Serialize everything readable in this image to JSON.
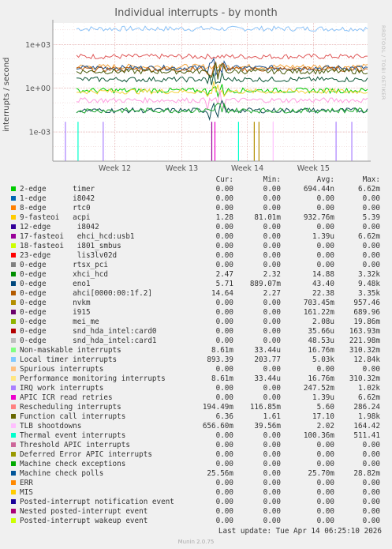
{
  "title": "Individual interrupts - by month",
  "watermark": "RRDTOOL / TOBI OETIKER",
  "chart_data": {
    "type": "line",
    "ylabel": "interrupts / second",
    "yscale": "log",
    "ylim": [
      1e-05,
      30000
    ],
    "yticks": [
      {
        "value": 1000,
        "label": "1e+03"
      },
      {
        "value": 1,
        "label": "1e+00"
      },
      {
        "value": 0.001,
        "label": "1e-03"
      }
    ],
    "xticks": [
      "Week 12",
      "Week 13",
      "Week 14",
      "Week 15"
    ],
    "grid": true,
    "series": [
      {
        "name": "Local timer interrupts",
        "color": "#8dc3f7",
        "level": 12000
      },
      {
        "name": "Rescheduling interrupts",
        "color": "#e05a5a",
        "level": 150
      },
      {
        "name": "Non-maskable interrupts",
        "color": "#f2a33d",
        "level": 30
      },
      {
        "name": "Machine check polls",
        "color": "#1b4f8a",
        "level": 25
      },
      {
        "name": "ahci[0000:00:1f.2]",
        "color": "#b7580d",
        "level": 20
      },
      {
        "name": "Function call interrupts",
        "color": "#4b5e11",
        "level": 14
      },
      {
        "name": "xhci_hcd",
        "color": "#11583a",
        "level": 4
      },
      {
        "name": "timer",
        "color": "#00cc00",
        "level": 0.7
      },
      {
        "name": "acpi",
        "color": "#f5d33d",
        "level": 0.6
      },
      {
        "name": "TLB shootdowns",
        "color": "#ff9ee0",
        "level": 0.15
      },
      {
        "name": "eno1",
        "color": "#0f4c55",
        "level": 0.03
      },
      {
        "name": "Thermal event interrupts",
        "color": "#22aa33",
        "level": 0.03
      }
    ]
  },
  "legend": {
    "headers": [
      "Cur:",
      "Min:",
      "Avg:",
      "Max:"
    ],
    "rows": [
      {
        "color": "#00cc00",
        "name": "2-edge      timer",
        "cur": "0.00",
        "min": "0.00",
        "avg": "694.44n",
        "max": "6.62m"
      },
      {
        "color": "#0066b3",
        "name": "1-edge      i8042",
        "cur": "0.00",
        "min": "0.00",
        "avg": "0.00",
        "max": "0.00"
      },
      {
        "color": "#ff8000",
        "name": "8-edge      rtc0",
        "cur": "0.00",
        "min": "0.00",
        "avg": "0.00",
        "max": "0.00"
      },
      {
        "color": "#ffcc00",
        "name": "9-fasteoi   acpi",
        "cur": "1.28",
        "min": "81.01m",
        "avg": "932.76m",
        "max": "5.39"
      },
      {
        "color": "#330099",
        "name": "12-edge      i8042",
        "cur": "0.00",
        "min": "0.00",
        "avg": "0.00",
        "max": "0.00"
      },
      {
        "color": "#990099",
        "name": "17-fasteoi   ehci_hcd:usb1",
        "cur": "0.00",
        "min": "0.00",
        "avg": "1.39u",
        "max": "6.62m"
      },
      {
        "color": "#ccff00",
        "name": "18-fasteoi   i801_smbus",
        "cur": "0.00",
        "min": "0.00",
        "avg": "0.00",
        "max": "0.00"
      },
      {
        "color": "#ff0000",
        "name": "23-edge      lis3lv02d",
        "cur": "0.00",
        "min": "0.00",
        "avg": "0.00",
        "max": "0.00"
      },
      {
        "color": "#808080",
        "name": "0-edge      rtsx_pci",
        "cur": "0.00",
        "min": "0.00",
        "avg": "0.00",
        "max": "0.00"
      },
      {
        "color": "#008f00",
        "name": "0-edge      xhci_hcd",
        "cur": "2.47",
        "min": "2.32",
        "avg": "14.88",
        "max": "3.32k"
      },
      {
        "color": "#00487d",
        "name": "0-edge      eno1",
        "cur": "5.71",
        "min": "889.07m",
        "avg": "43.40",
        "max": "9.48k"
      },
      {
        "color": "#b35a00",
        "name": "0-edge      ahci[0000:00:1f.2]",
        "cur": "14.64",
        "min": "2.27",
        "avg": "22.38",
        "max": "3.35k"
      },
      {
        "color": "#b38f00",
        "name": "0-edge      nvkm",
        "cur": "0.00",
        "min": "0.00",
        "avg": "703.45m",
        "max": "957.46"
      },
      {
        "color": "#6b006b",
        "name": "0-edge      i915",
        "cur": "0.00",
        "min": "0.00",
        "avg": "161.22m",
        "max": "689.96"
      },
      {
        "color": "#8fb300",
        "name": "0-edge      mei_me",
        "cur": "0.00",
        "min": "0.00",
        "avg": "2.08u",
        "max": "19.86m"
      },
      {
        "color": "#b30000",
        "name": "0-edge      snd_hda_intel:card0",
        "cur": "0.00",
        "min": "0.00",
        "avg": "35.66u",
        "max": "163.93m"
      },
      {
        "color": "#bebebe",
        "name": "0-edge      snd_hda_intel:card1",
        "cur": "0.00",
        "min": "0.00",
        "avg": "48.53u",
        "max": "221.98m"
      },
      {
        "color": "#80ff80",
        "name": "Non-maskable interrupts",
        "cur": "8.61m",
        "min": "33.44u",
        "avg": "16.76m",
        "max": "310.32m"
      },
      {
        "color": "#80c9ff",
        "name": "Local timer interrupts",
        "cur": "893.39",
        "min": "203.77",
        "avg": "5.03k",
        "max": "12.84k"
      },
      {
        "color": "#ffc080",
        "name": "Spurious interrupts",
        "cur": "0.00",
        "min": "0.00",
        "avg": "0.00",
        "max": "0.00"
      },
      {
        "color": "#ffe680",
        "name": "Performance monitoring interrupts",
        "cur": "8.61m",
        "min": "33.44u",
        "avg": "16.76m",
        "max": "310.32m"
      },
      {
        "color": "#aa80ff",
        "name": "IRQ work interrupts",
        "cur": "0.00",
        "min": "0.00",
        "avg": "247.52m",
        "max": "1.02k"
      },
      {
        "color": "#ee00cc",
        "name": "APIC ICR read retries",
        "cur": "0.00",
        "min": "0.00",
        "avg": "1.39u",
        "max": "6.62m"
      },
      {
        "color": "#ff8080",
        "name": "Rescheduling interrupts",
        "cur": "194.49m",
        "min": "116.85m",
        "avg": "5.60",
        "max": "286.24"
      },
      {
        "color": "#666600",
        "name": "Function call interrupts",
        "cur": "6.36",
        "min": "1.61",
        "avg": "17.10",
        "max": "1.98k"
      },
      {
        "color": "#ffbfff",
        "name": "TLB shootdowns",
        "cur": "656.60m",
        "min": "39.56m",
        "avg": "2.02",
        "max": "164.42"
      },
      {
        "color": "#00ffcc",
        "name": "Thermal event interrupts",
        "cur": "0.00",
        "min": "0.00",
        "avg": "100.36m",
        "max": "511.41"
      },
      {
        "color": "#cc6699",
        "name": "Threshold APIC interrupts",
        "cur": "0.00",
        "min": "0.00",
        "avg": "0.00",
        "max": "0.00"
      },
      {
        "color": "#999900",
        "name": "Deferred Error APIC interrupts",
        "cur": "0.00",
        "min": "0.00",
        "avg": "0.00",
        "max": "0.00"
      },
      {
        "color": "#00aa00",
        "name": "Machine check exceptions",
        "cur": "0.00",
        "min": "0.00",
        "avg": "0.00",
        "max": "0.00"
      },
      {
        "color": "#005599",
        "name": "Machine check polls",
        "cur": "25.56m",
        "min": "0.00",
        "avg": "25.70m",
        "max": "28.82m"
      },
      {
        "color": "#ff8800",
        "name": "ERR",
        "cur": "0.00",
        "min": "0.00",
        "avg": "0.00",
        "max": "0.00"
      },
      {
        "color": "#ffcc00",
        "name": "MIS",
        "cur": "0.00",
        "min": "0.00",
        "avg": "0.00",
        "max": "0.00"
      },
      {
        "color": "#1a0099",
        "name": "Posted-interrupt notification event",
        "cur": "0.00",
        "min": "0.00",
        "avg": "0.00",
        "max": "0.00"
      },
      {
        "color": "#aa0077",
        "name": "Nested posted-interrupt event",
        "cur": "0.00",
        "min": "0.00",
        "avg": "0.00",
        "max": "0.00"
      },
      {
        "color": "#ccff00",
        "name": "Posted-interrupt wakeup event",
        "cur": "0.00",
        "min": "0.00",
        "avg": "0.00",
        "max": "0.00"
      }
    ]
  },
  "last_update": "Last update: Tue Apr 14 06:25:10 2026",
  "footer": "Munin 2.0.75"
}
